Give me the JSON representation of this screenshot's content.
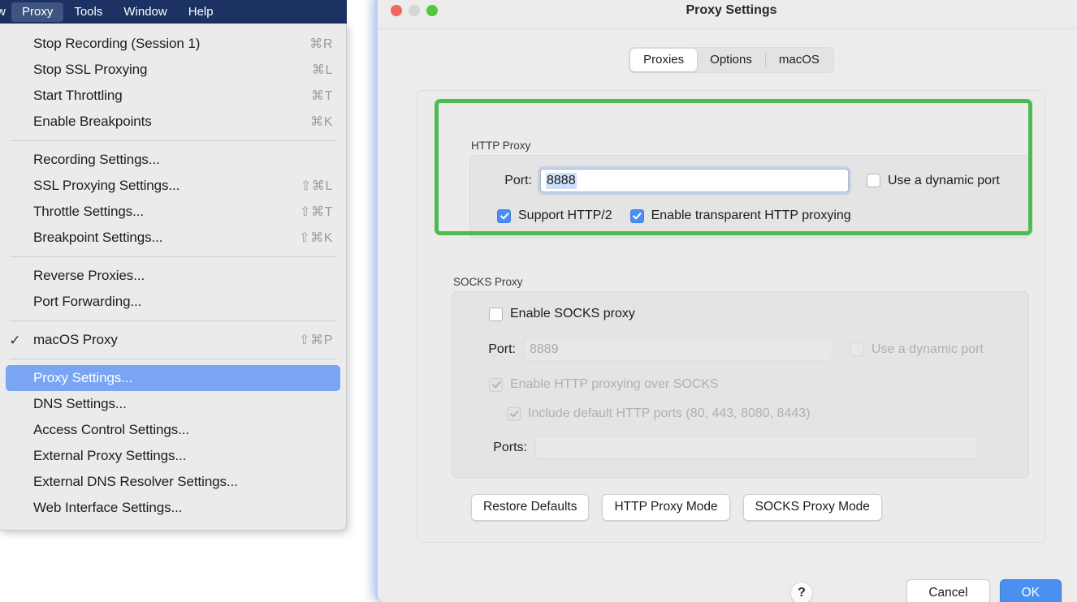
{
  "menubar": {
    "partial_left_item": "w",
    "items": [
      {
        "label": "Proxy",
        "active": true
      },
      {
        "label": "Tools",
        "active": false
      },
      {
        "label": "Window",
        "active": false
      },
      {
        "label": "Help",
        "active": false
      }
    ]
  },
  "menu": {
    "groups": [
      {
        "rows": [
          {
            "check": "",
            "label": "Stop Recording (Session 1)",
            "shortcut": "⌘R",
            "selected": false
          },
          {
            "check": "",
            "label": "Stop SSL Proxying",
            "shortcut": "⌘L",
            "selected": false
          },
          {
            "check": "",
            "label": "Start Throttling",
            "shortcut": "⌘T",
            "selected": false
          },
          {
            "check": "",
            "label": "Enable Breakpoints",
            "shortcut": "⌘K",
            "selected": false
          }
        ]
      },
      {
        "rows": [
          {
            "check": "",
            "label": "Recording Settings...",
            "shortcut": "",
            "selected": false
          },
          {
            "check": "",
            "label": "SSL Proxying Settings...",
            "shortcut": "⇧⌘L",
            "selected": false
          },
          {
            "check": "",
            "label": "Throttle Settings...",
            "shortcut": "⇧⌘T",
            "selected": false
          },
          {
            "check": "",
            "label": "Breakpoint Settings...",
            "shortcut": "⇧⌘K",
            "selected": false
          }
        ]
      },
      {
        "rows": [
          {
            "check": "",
            "label": "Reverse Proxies...",
            "shortcut": "",
            "selected": false
          },
          {
            "check": "",
            "label": "Port Forwarding...",
            "shortcut": "",
            "selected": false
          }
        ]
      },
      {
        "rows": [
          {
            "check": "✓",
            "label": "macOS Proxy",
            "shortcut": "⇧⌘P",
            "selected": false
          }
        ]
      },
      {
        "rows": [
          {
            "check": "",
            "label": "Proxy Settings...",
            "shortcut": "",
            "selected": true
          },
          {
            "check": "",
            "label": "DNS Settings...",
            "shortcut": "",
            "selected": false
          },
          {
            "check": "",
            "label": "Access Control Settings...",
            "shortcut": "",
            "selected": false
          },
          {
            "check": "",
            "label": "External Proxy Settings...",
            "shortcut": "",
            "selected": false
          },
          {
            "check": "",
            "label": "External DNS Resolver Settings...",
            "shortcut": "",
            "selected": false
          },
          {
            "check": "",
            "label": "Web Interface Settings...",
            "shortcut": "",
            "selected": false
          }
        ]
      }
    ]
  },
  "dialog": {
    "title": "Proxy Settings",
    "tabs": [
      {
        "label": "Proxies",
        "active": true
      },
      {
        "label": "Options",
        "active": false
      },
      {
        "label": "macOS",
        "active": false
      }
    ],
    "http_proxy": {
      "group_label": "HTTP Proxy",
      "port_label": "Port:",
      "port_value": "8888",
      "dynamic_port_label": "Use a dynamic port",
      "dynamic_port_checked": false,
      "support_http2_label": "Support HTTP/2",
      "support_http2_checked": true,
      "transparent_label": "Enable transparent HTTP proxying",
      "transparent_checked": true
    },
    "socks_proxy": {
      "group_label": "SOCKS Proxy",
      "enable_label": "Enable SOCKS proxy",
      "enable_checked": false,
      "port_label": "Port:",
      "port_value": "8889",
      "dynamic_port_label": "Use a dynamic port",
      "dynamic_port_checked": false,
      "http_over_socks_label": "Enable HTTP proxying over SOCKS",
      "http_over_socks_checked": true,
      "include_default_label": "Include default HTTP ports (80, 443, 8080, 8443)",
      "include_default_checked": true,
      "ports_label": "Ports:",
      "ports_value": ""
    },
    "mode_buttons": [
      {
        "label": "Restore Defaults"
      },
      {
        "label": "HTTP Proxy Mode"
      },
      {
        "label": "SOCKS Proxy Mode"
      }
    ],
    "help_label": "?",
    "cancel_label": "Cancel",
    "ok_label": "OK"
  },
  "annotation": {
    "highlight_color": "#4cbb52"
  }
}
